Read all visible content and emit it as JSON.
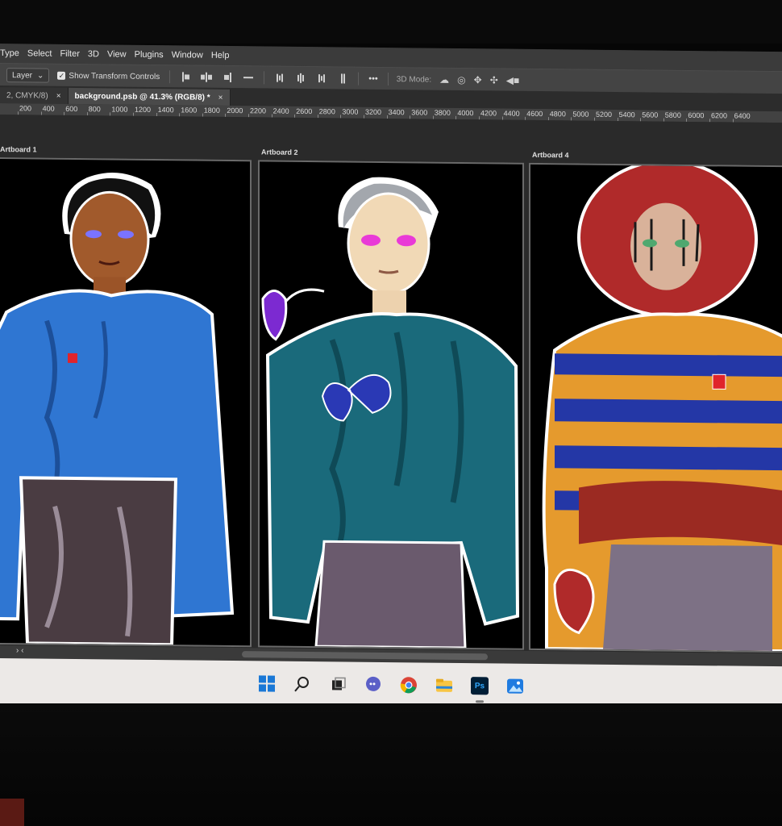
{
  "menu": {
    "items": [
      "Type",
      "Select",
      "Filter",
      "3D",
      "View",
      "Plugins",
      "Window",
      "Help"
    ]
  },
  "options": {
    "layer_select": "Layer",
    "show_transform_label": "Show Transform Controls",
    "more_label": "•••",
    "mode_label": "3D Mode:"
  },
  "tabs": [
    {
      "label": "2, CMYK/8)",
      "close": "×"
    },
    {
      "label": "background.psb @ 41.3% (RGB/8) *",
      "close": "×"
    }
  ],
  "ruler": {
    "ticks": [
      "200",
      "400",
      "600",
      "800",
      "1000",
      "1200",
      "1400",
      "1600",
      "1800",
      "2000",
      "2200",
      "2400",
      "2600",
      "2800",
      "3000",
      "3200",
      "3400",
      "3600",
      "3800",
      "4000",
      "4200",
      "4400",
      "4600",
      "4800",
      "5000",
      "5200",
      "5400",
      "5600",
      "5800",
      "6000",
      "6200",
      "6400"
    ]
  },
  "artboards": [
    {
      "label": "Artboard 1"
    },
    {
      "label": "Artboard 2"
    },
    {
      "label": "Artboard 4"
    }
  ],
  "status": {
    "left_arrows": "›  ‹"
  },
  "taskbar": {
    "apps": [
      "start-icon",
      "search-icon",
      "task-view-icon",
      "teams-chat-icon",
      "chrome-icon",
      "file-explorer-icon",
      "photoshop-icon",
      "photos-icon"
    ],
    "photoshop_label": "Ps"
  },
  "colors": {
    "ps_bg": "#001e36",
    "ps_text": "#31a8ff",
    "accent_blue": "#0078d4"
  }
}
